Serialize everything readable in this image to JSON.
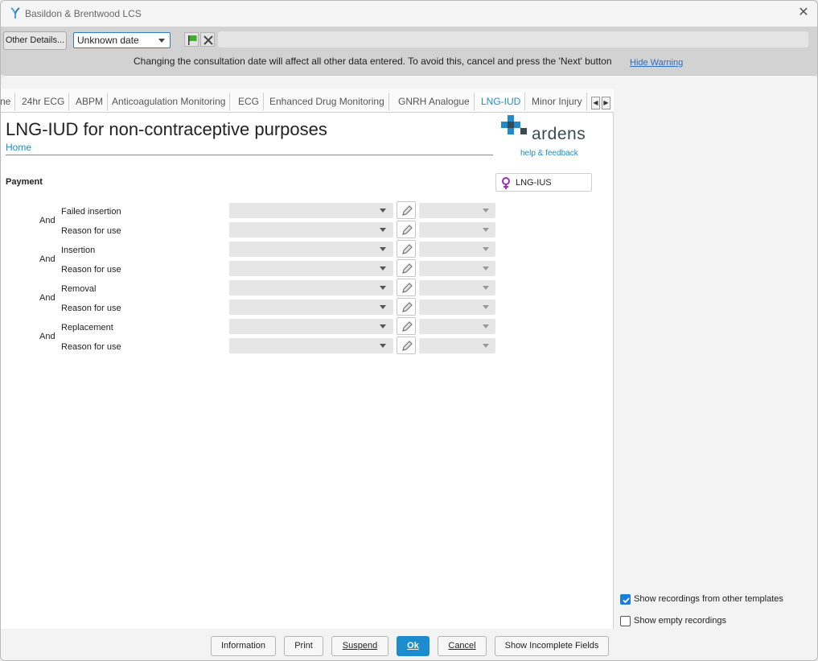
{
  "window": {
    "title": "Basildon & Brentwood LCS"
  },
  "topbar": {
    "other_details": "Other Details...",
    "date_value": "Unknown date",
    "warning": "Changing the consultation date will affect all other data entered. To avoid this, cancel and press the 'Next' button",
    "hide_warning": "Hide Warning"
  },
  "tabs": [
    {
      "label": "ne",
      "active": false
    },
    {
      "label": "24hr ECG",
      "active": false
    },
    {
      "label": "ABPM",
      "active": false
    },
    {
      "label": "Anticoagulation Monitoring",
      "active": false
    },
    {
      "label": "ECG",
      "active": false
    },
    {
      "label": "Enhanced Drug Monitoring",
      "active": false
    },
    {
      "label": "GNRH Analogue",
      "active": false
    },
    {
      "label": "LNG-IUD",
      "active": true
    },
    {
      "label": "Minor Injury",
      "active": false
    }
  ],
  "form": {
    "title": "LNG-IUD for non-contraceptive purposes",
    "home_link": "Home",
    "logo_text": "ardens",
    "logo_sub": "help & feedback",
    "section": "Payment",
    "lng_ius_label": "LNG-IUS",
    "and_label": "And",
    "groups": [
      {
        "label1": "Failed insertion",
        "label2": "Reason for use"
      },
      {
        "label1": "Insertion",
        "label2": "Reason for use"
      },
      {
        "label1": "Removal",
        "label2": "Reason for use"
      },
      {
        "label1": "Replacement",
        "label2": "Reason for use"
      }
    ]
  },
  "options": {
    "show_other": {
      "label": "Show recordings from other templates",
      "checked": true
    },
    "show_empty": {
      "label": "Show empty recordings",
      "checked": false
    }
  },
  "footer": {
    "information": "Information",
    "print": "Print",
    "suspend": "Suspend",
    "ok": "Ok",
    "cancel": "Cancel",
    "show_incomplete": "Show Incomplete Fields"
  },
  "colors": {
    "accent": "#1d8ccf",
    "checkbox": "#1d7cd6",
    "female_icon": "#9b2fb5",
    "flag": "#3fae2a"
  }
}
